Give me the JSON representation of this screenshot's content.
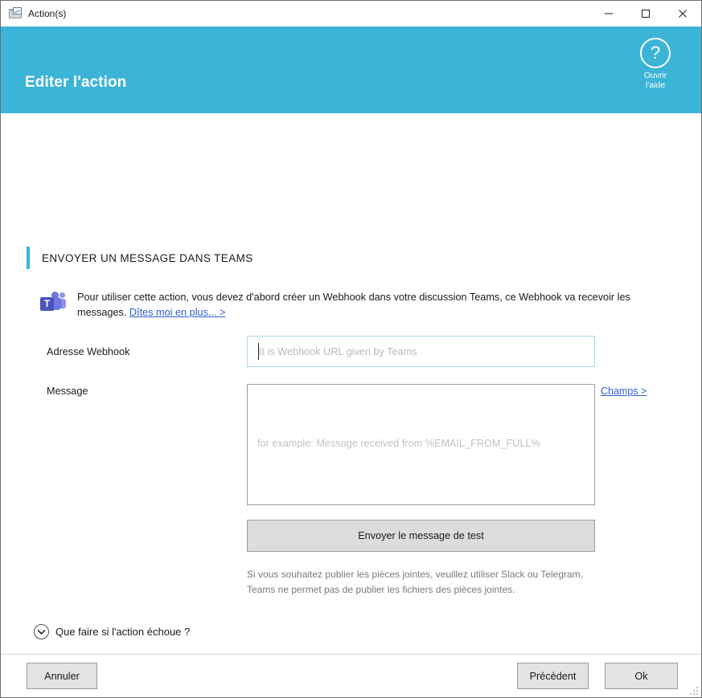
{
  "window": {
    "title": "Action(s)",
    "icon": "mail-chart-icon",
    "controls": {
      "minimize": "minimize-icon",
      "maximize": "maximize-icon",
      "close": "close-icon"
    }
  },
  "header": {
    "title": "Editer l'action",
    "accent_color": "#3cb4d8",
    "help": {
      "icon": "question-mark-icon",
      "line1": "Ouvrir",
      "line2": "l'aide"
    }
  },
  "section": {
    "title": "ENVOYER UN MESSAGE DANS TEAMS"
  },
  "info": {
    "icon": "microsoft-teams-icon",
    "text": "Pour utiliser cette action, vous devez d'abord créer un Webhook dans votre discussion Teams, ce Webhook va recevoir les messages.",
    "link": "Dîtes moi en plus... >"
  },
  "form": {
    "webhook": {
      "label": "Adresse Webhook",
      "value": "",
      "placeholder": "It is Webhook URL given by Teams"
    },
    "message": {
      "label": "Message",
      "value": "",
      "placeholder": "for example: Message received from %EMAIL_FROM_FULL%"
    },
    "fields_link": "Champs >",
    "test_button": "Envoyer le message de test",
    "note": "Si vous souhaitez publier les pièces jointes, veuillez utiliser Slack ou Telegram, Teams ne permet pas de publier les fichiers des pièces jointes."
  },
  "collapse": {
    "icon": "chevron-down-icon",
    "label": "Que faire si l'action échoue ?"
  },
  "footer": {
    "cancel": "Annuler",
    "previous": "Précèdent",
    "ok": "Ok"
  }
}
